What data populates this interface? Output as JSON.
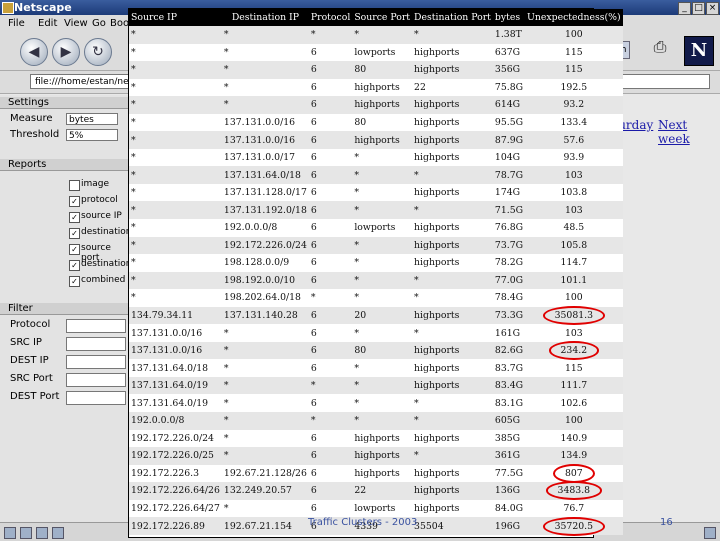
{
  "window": {
    "title": "Netscape"
  },
  "menu": {
    "items": [
      "File",
      "Edit",
      "View",
      "Go",
      "Boo"
    ]
  },
  "search_button": "Search",
  "location": {
    "value": "file:///home/estan/new"
  },
  "left_panel": {
    "settings_heading": "Settings",
    "measure_label": "Measure",
    "measure_value": "bytes",
    "threshold_label": "Threshold",
    "threshold_value": "5%",
    "reports_heading": "Reports",
    "report_items": [
      {
        "label": "image",
        "checked": false
      },
      {
        "label": "protocol",
        "checked": true
      },
      {
        "label": "source IP",
        "checked": true
      },
      {
        "label": "destination",
        "checked": true
      },
      {
        "label": "source port",
        "checked": true
      },
      {
        "label": "destination",
        "checked": true
      },
      {
        "label": "combined",
        "checked": true
      }
    ],
    "filter_heading": "Filter",
    "filter_fields": [
      "Protocol",
      "SRC IP",
      "DEST IP",
      "SRC Port",
      "DEST Port"
    ]
  },
  "nav_links": {
    "saturday": "Saturday",
    "next_week": "Next week"
  },
  "table": {
    "headers": [
      "Source IP",
      "Destination IP",
      "Protocol",
      "Source Port",
      "Destination Port",
      "bytes",
      "Unexpectedness(%)"
    ],
    "rows": [
      [
        "*",
        "*",
        "*",
        "*",
        "*",
        "1.38T",
        "100"
      ],
      [
        "*",
        "*",
        "6",
        "lowports",
        "highports",
        "637G",
        "115"
      ],
      [
        "*",
        "*",
        "6",
        "80",
        "highports",
        "356G",
        "115"
      ],
      [
        "*",
        "*",
        "6",
        "highports",
        "22",
        "75.8G",
        "192.5"
      ],
      [
        "*",
        "*",
        "6",
        "highports",
        "highports",
        "614G",
        "93.2"
      ],
      [
        "*",
        "137.131.0.0/16",
        "6",
        "80",
        "highports",
        "95.5G",
        "133.4"
      ],
      [
        "*",
        "137.131.0.0/16",
        "6",
        "highports",
        "highports",
        "87.9G",
        "57.6"
      ],
      [
        "*",
        "137.131.0.0/17",
        "6",
        "*",
        "highports",
        "104G",
        "93.9"
      ],
      [
        "*",
        "137.131.64.0/18",
        "6",
        "*",
        "*",
        "78.7G",
        "103"
      ],
      [
        "*",
        "137.131.128.0/17",
        "6",
        "*",
        "highports",
        "174G",
        "103.8"
      ],
      [
        "*",
        "137.131.192.0/18",
        "6",
        "*",
        "*",
        "71.5G",
        "103"
      ],
      [
        "*",
        "192.0.0.0/8",
        "6",
        "lowports",
        "highports",
        "76.8G",
        "48.5"
      ],
      [
        "*",
        "192.172.226.0/24",
        "6",
        "*",
        "highports",
        "73.7G",
        "105.8"
      ],
      [
        "*",
        "198.128.0.0/9",
        "6",
        "*",
        "highports",
        "78.2G",
        "114.7"
      ],
      [
        "*",
        "198.192.0.0/10",
        "6",
        "*",
        "*",
        "77.0G",
        "101.1"
      ],
      [
        "*",
        "198.202.64.0/18",
        "*",
        "*",
        "*",
        "78.4G",
        "100"
      ],
      [
        "134.79.34.11",
        "137.131.140.28",
        "6",
        "20",
        "highports",
        "73.3G",
        "35081.3"
      ],
      [
        "137.131.0.0/16",
        "*",
        "6",
        "*",
        "*",
        "161G",
        "103"
      ],
      [
        "137.131.0.0/16",
        "*",
        "6",
        "80",
        "highports",
        "82.6G",
        "234.2"
      ],
      [
        "137.131.64.0/18",
        "*",
        "6",
        "*",
        "highports",
        "83.7G",
        "115"
      ],
      [
        "137.131.64.0/19",
        "*",
        "*",
        "*",
        "highports",
        "83.4G",
        "111.7"
      ],
      [
        "137.131.64.0/19",
        "*",
        "6",
        "*",
        "*",
        "83.1G",
        "102.6"
      ],
      [
        "192.0.0.0/8",
        "*",
        "*",
        "*",
        "*",
        "605G",
        "100"
      ],
      [
        "192.172.226.0/24",
        "*",
        "6",
        "highports",
        "highports",
        "385G",
        "140.9"
      ],
      [
        "192.172.226.0/25",
        "*",
        "6",
        "highports",
        "*",
        "361G",
        "134.9"
      ],
      [
        "192.172.226.3",
        "192.67.21.128/26",
        "6",
        "highports",
        "highports",
        "77.5G",
        "807"
      ],
      [
        "192.172.226.64/26",
        "132.249.20.57",
        "6",
        "22",
        "highports",
        "136G",
        "3483.8"
      ],
      [
        "192.172.226.64/27",
        "*",
        "6",
        "lowports",
        "highports",
        "84.0G",
        "76.7"
      ],
      [
        "192.172.226.89",
        "192.67.21.154",
        "6",
        "4339",
        "35504",
        "196G",
        "35720.5"
      ]
    ],
    "circled_rows": [
      16,
      18,
      25,
      26,
      28
    ]
  },
  "footer": {
    "caption": "Traffic Clusters - 2003",
    "page": "16"
  }
}
